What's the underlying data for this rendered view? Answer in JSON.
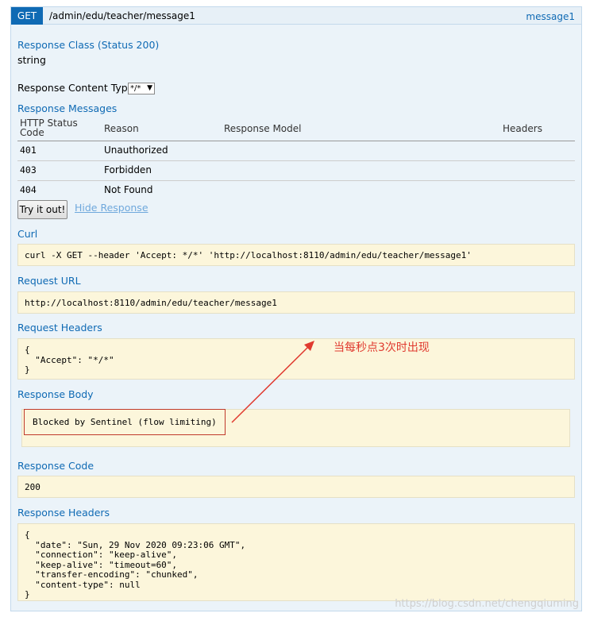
{
  "operation": {
    "method": "GET",
    "path": "/admin/edu/teacher/message1",
    "nickname": "message1"
  },
  "response_class": {
    "label": "Response Class (Status 200)",
    "type": "string"
  },
  "content_type": {
    "label": "Response Content Type",
    "selected": "*/*"
  },
  "response_messages": {
    "label": "Response Messages",
    "headers": [
      "HTTP Status Code",
      "Reason",
      "Response Model",
      "Headers"
    ],
    "rows": [
      {
        "code": "401",
        "reason": "Unauthorized"
      },
      {
        "code": "403",
        "reason": "Forbidden"
      },
      {
        "code": "404",
        "reason": "Not Found"
      }
    ]
  },
  "actions": {
    "try_label": "Try it out!",
    "hide_label": "Hide Response"
  },
  "curl": {
    "label": "Curl",
    "value": "curl -X GET --header 'Accept: */*' 'http://localhost:8110/admin/edu/teacher/message1'"
  },
  "request_url": {
    "label": "Request URL",
    "value": "http://localhost:8110/admin/edu/teacher/message1"
  },
  "request_headers": {
    "label": "Request Headers",
    "lines": [
      "{",
      "  \"Accept\": \"*/*\"",
      "}"
    ]
  },
  "response_body": {
    "label": "Response Body",
    "value": "Blocked by Sentinel (flow limiting)"
  },
  "response_code": {
    "label": "Response Code",
    "value": "200"
  },
  "response_headers": {
    "label": "Response Headers",
    "lines": [
      "{",
      "  \"date\": \"Sun, 29 Nov 2020 09:23:06 GMT\",",
      "  \"connection\": \"keep-alive\",",
      "  \"keep-alive\": \"timeout=60\",",
      "  \"transfer-encoding\": \"chunked\",",
      "  \"content-type\": null",
      "}"
    ]
  },
  "annotation": {
    "text": "当每秒点3次时出现",
    "color": "#e03a2f"
  },
  "watermark": "https://blog.csdn.net/chengqiuming",
  "colors": {
    "method_bg": "#0f6ab4",
    "label": "#0f6ab4",
    "code_block_bg": "#fcf6db",
    "panel_bg": "#ebf3f9"
  }
}
